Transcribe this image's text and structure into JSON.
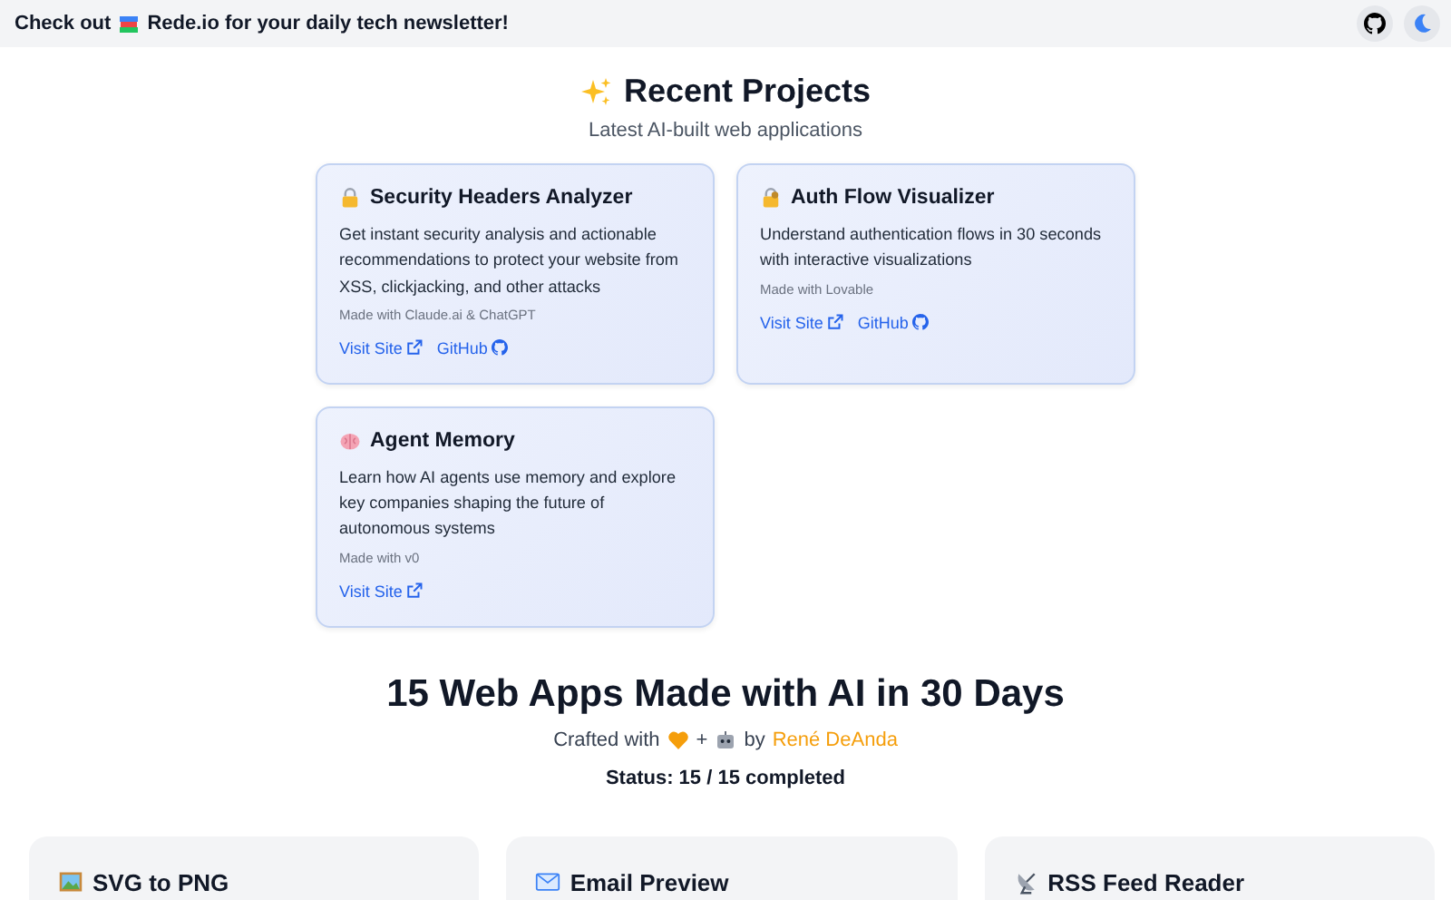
{
  "banner": {
    "before": "Check out",
    "after": "Rede.io for your daily tech newsletter!"
  },
  "recent": {
    "title": "Recent Projects",
    "subtitle": "Latest AI-built web applications",
    "projects": [
      {
        "kind": "lock",
        "title": "Security Headers Analyzer",
        "description": "Get instant security analysis and actionable recommendations to protect your website from XSS, clickjacking, and other attacks",
        "made_with": "Made with Claude.ai & ChatGPT",
        "links": [
          {
            "kind": "external",
            "label": "Visit Site"
          },
          {
            "kind": "github",
            "label": "GitHub"
          }
        ]
      },
      {
        "kind": "lock-key",
        "title": "Auth Flow Visualizer",
        "description": "Understand authentication flows in 30 seconds with interactive visualizations",
        "made_with": "Made with Lovable",
        "links": [
          {
            "kind": "external",
            "label": "Visit Site"
          },
          {
            "kind": "github",
            "label": "GitHub"
          }
        ]
      },
      {
        "kind": "brain",
        "title": "Agent Memory",
        "description": "Learn how AI agents use memory and explore key companies shaping the future of autonomous systems",
        "made_with": "Made with v0",
        "links": [
          {
            "kind": "external",
            "label": "Visit Site"
          }
        ]
      }
    ]
  },
  "challenge": {
    "title": "15 Web Apps Made with AI in 30 Days",
    "crafted": "Crafted with",
    "plus": "+",
    "by": "by",
    "author": "René DeAnda",
    "status": "Status: 15 / 15 completed"
  },
  "apps": [
    {
      "kind": "picture",
      "title": "SVG to PNG"
    },
    {
      "kind": "envelope",
      "title": "Email Preview"
    },
    {
      "kind": "antenna",
      "title": "RSS Feed Reader"
    }
  ]
}
